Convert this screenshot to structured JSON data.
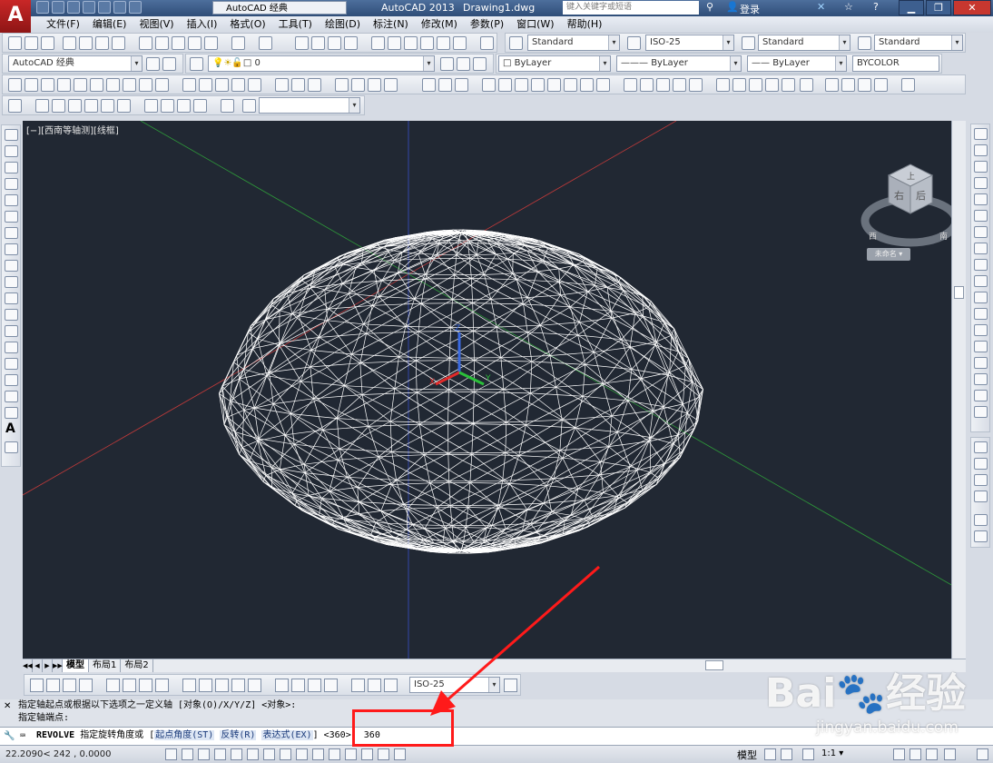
{
  "titlebar": {
    "workspace": "AutoCAD 经典",
    "app_name": "AutoCAD 2013",
    "doc_name": "Drawing1.dwg",
    "search_placeholder": "键入关键字或短语",
    "login": "登录",
    "help": "?"
  },
  "menu": [
    "文件(F)",
    "编辑(E)",
    "视图(V)",
    "插入(I)",
    "格式(O)",
    "工具(T)",
    "绘图(D)",
    "标注(N)",
    "修改(M)",
    "参数(P)",
    "窗口(W)",
    "帮助(H)"
  ],
  "styles": {
    "text_style": "Standard",
    "dim_style": "ISO-25",
    "table_style": "Standard",
    "mleader_style": "Standard"
  },
  "layers": {
    "workspace_combo": "AutoCAD 经典",
    "layer": "0",
    "color": "ByLayer",
    "linetype": "ByLayer",
    "lineweight": "ByLayer",
    "plotstyle": "BYCOLOR"
  },
  "viewport": {
    "label": "[−][西南等轴测][线框]",
    "viewcube_face_top": "上",
    "viewcube_face_front": "右",
    "viewcube_face_side": "后",
    "compass_w": "西",
    "compass_s": "南",
    "ucs_name": "未命名",
    "ucs_x": "X",
    "ucs_y": "Y",
    "ucs_z": "Z"
  },
  "tabs": [
    "模型",
    "布局1",
    "布局2"
  ],
  "dim_toolbar": {
    "dim_style": "ISO-25"
  },
  "command": {
    "history_1": "指定轴起点或根据以下选项之一定义轴 [对象(O)/X/Y/Z] <对象>:",
    "history_2": "指定轴端点:",
    "name": "REVOLVE",
    "prompt": "指定旋转角度或",
    "opt_start_open": "[",
    "opt1": "起点角度(ST)",
    "opt2": "反转(R)",
    "opt3": "表达式(EX)",
    "opt_end": "]",
    "default": "<360>:",
    "value": "360"
  },
  "status": {
    "coords": "22.2090<  242        , 0.0000",
    "model": "模型",
    "scale": "1:1 ▾"
  },
  "watermark": {
    "brand": "Bai",
    "brand2": "经验",
    "url": "jingyan.baidu.com"
  },
  "colors": {
    "viewport_bg": "#212833",
    "wire": "#ffffff",
    "axis_x": "#e02a2a",
    "axis_y": "#2bbf3a",
    "axis_z": "#3a5fe0",
    "annotation_red": "#ff1a1a"
  }
}
